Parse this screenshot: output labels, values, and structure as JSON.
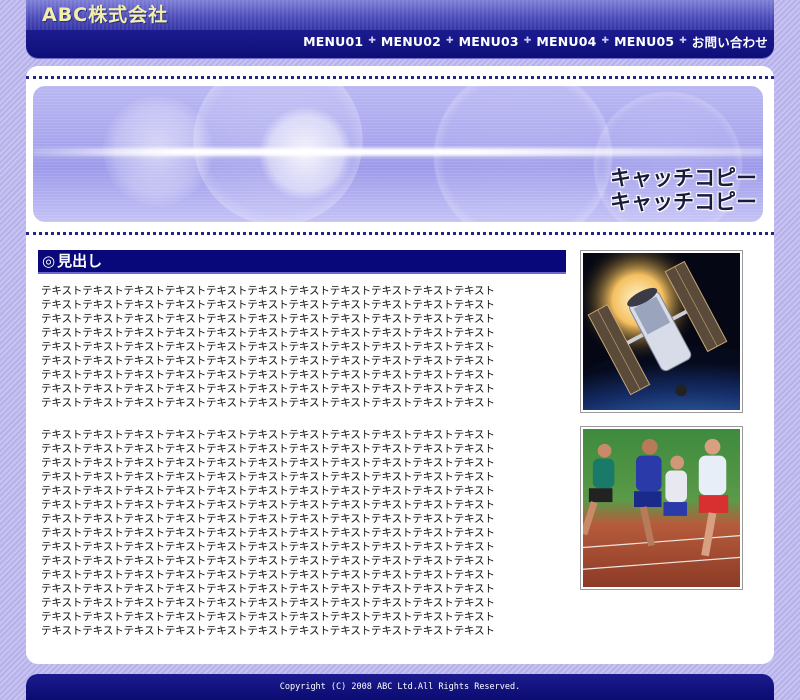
{
  "header": {
    "logo_text": "ABC株式会社",
    "nav": [
      {
        "label": "MENU01"
      },
      {
        "label": "MENU02"
      },
      {
        "label": "MENU03"
      },
      {
        "label": "MENU04"
      },
      {
        "label": "MENU05"
      },
      {
        "label": "お問い合わせ"
      }
    ]
  },
  "hero": {
    "catch_line1": "キャッチコピー",
    "catch_line2": "キャッチコピー"
  },
  "main": {
    "heading_icon": "double-circle-icon",
    "heading_mark": "◎",
    "heading": "見出し",
    "paragraph_line": "テキストテキストテキストテキストテキストテキストテキストテキストテキストテキストテキスト",
    "paragraph1_line_count": 9,
    "paragraph2_line_count": 15,
    "images": [
      {
        "name": "space-telescope-photo"
      },
      {
        "name": "runners-photo"
      }
    ]
  },
  "footer": {
    "copyright": "Copyright (C) 2008 ABC Ltd.All Rights Reserved."
  },
  "colors": {
    "navy": "#08087a",
    "accent_yellow": "#f3efa8",
    "background_lavender": "#bdb8ec"
  }
}
